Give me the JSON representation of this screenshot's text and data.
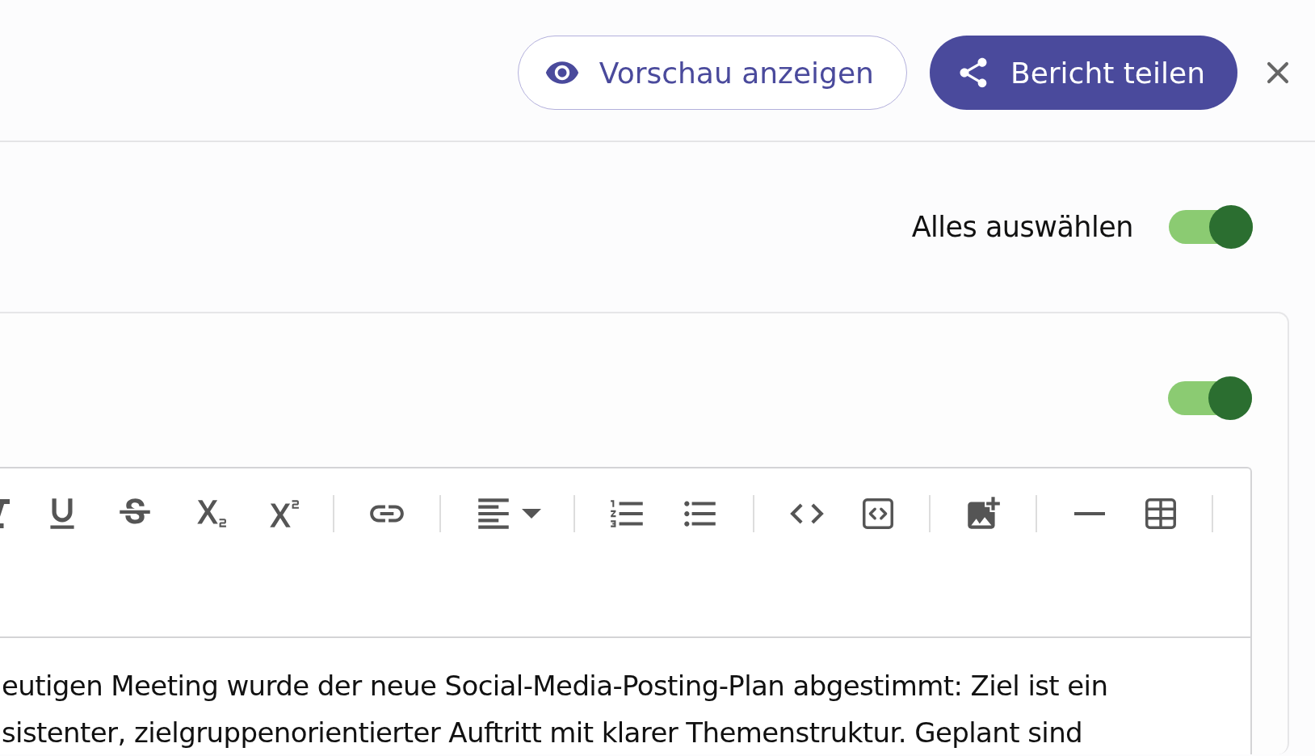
{
  "header": {
    "preview_button": {
      "label": "Vorschau anzeigen"
    },
    "share_button": {
      "label": "Bericht teilen"
    }
  },
  "select_all": {
    "label": "Alles auswählen",
    "on": true
  },
  "section": {
    "toggle": {
      "on": true
    },
    "editor": {
      "toolbar": [
        {
          "kind": "italic"
        },
        {
          "kind": "underline"
        },
        {
          "kind": "strikethrough"
        },
        {
          "kind": "subscript"
        },
        {
          "kind": "superscript"
        },
        {
          "kind": "separator"
        },
        {
          "kind": "link"
        },
        {
          "kind": "separator"
        },
        {
          "kind": "align"
        },
        {
          "kind": "separator"
        },
        {
          "kind": "ordered-list"
        },
        {
          "kind": "bullet-list"
        },
        {
          "kind": "separator"
        },
        {
          "kind": "code"
        },
        {
          "kind": "code-block"
        },
        {
          "kind": "separator"
        },
        {
          "kind": "image"
        },
        {
          "kind": "separator"
        },
        {
          "kind": "horizontal-rule"
        },
        {
          "kind": "table"
        },
        {
          "kind": "separator"
        }
      ],
      "lines": [
        "eutigen Meeting wurde der neue Social-Media-Posting-Plan abgestimmt: Ziel ist ein",
        "sistenter, zielgruppenorientierter Auftritt mit klarer Themenstruktur. Geplant sind"
      ]
    }
  }
}
